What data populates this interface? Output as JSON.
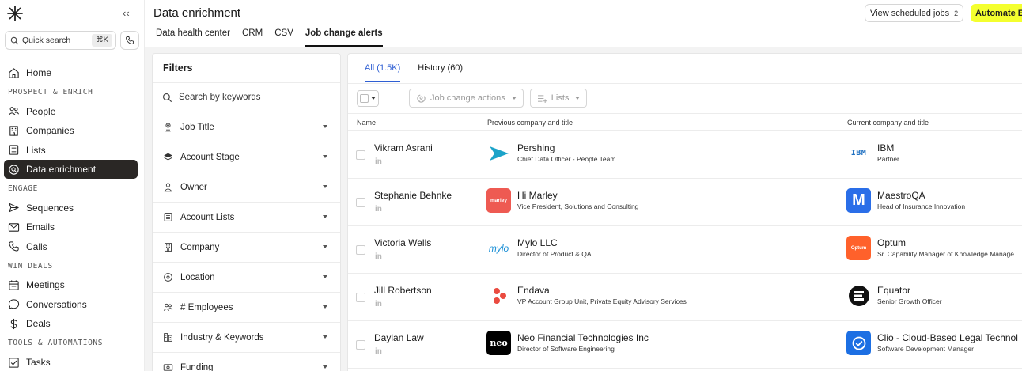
{
  "sidebar": {
    "collapse_label": "‹‹",
    "quick_search": "Quick search",
    "shortcut": "⌘K",
    "items": [
      {
        "type": "item",
        "label": "Home",
        "icon": "home-icon"
      },
      {
        "type": "section",
        "label": "PROSPECT & ENRICH"
      },
      {
        "type": "item",
        "label": "People",
        "icon": "people-icon"
      },
      {
        "type": "item",
        "label": "Companies",
        "icon": "building-icon"
      },
      {
        "type": "item",
        "label": "Lists",
        "icon": "list-icon"
      },
      {
        "type": "item",
        "label": "Data enrichment",
        "icon": "enrichment-icon",
        "active": true
      },
      {
        "type": "section",
        "label": "ENGAGE"
      },
      {
        "type": "item",
        "label": "Sequences",
        "icon": "send-icon"
      },
      {
        "type": "item",
        "label": "Emails",
        "icon": "mail-icon"
      },
      {
        "type": "item",
        "label": "Calls",
        "icon": "phone-icon"
      },
      {
        "type": "section",
        "label": "WIN DEALS"
      },
      {
        "type": "item",
        "label": "Meetings",
        "icon": "calendar-icon"
      },
      {
        "type": "item",
        "label": "Conversations",
        "icon": "chat-icon"
      },
      {
        "type": "item",
        "label": "Deals",
        "icon": "dollar-icon"
      },
      {
        "type": "section",
        "label": "TOOLS & AUTOMATIONS"
      },
      {
        "type": "item",
        "label": "Tasks",
        "icon": "checkbox-icon"
      }
    ]
  },
  "header": {
    "title": "Data enrichment",
    "tabs": [
      {
        "label": "Data health center",
        "active": false
      },
      {
        "label": "CRM",
        "active": false
      },
      {
        "label": "CSV",
        "active": false
      },
      {
        "label": "Job change alerts",
        "active": true
      }
    ],
    "scheduled_label": "View scheduled jobs",
    "scheduled_count": "2",
    "automate_label": "Automate En"
  },
  "filters": {
    "title": "Filters",
    "search_placeholder": "Search by keywords",
    "items": [
      {
        "label": "Job Title",
        "icon": "badge-icon"
      },
      {
        "label": "Account Stage",
        "icon": "layers-icon"
      },
      {
        "label": "Owner",
        "icon": "person-icon"
      },
      {
        "label": "Account Lists",
        "icon": "list-icon"
      },
      {
        "label": "Company",
        "icon": "building-icon"
      },
      {
        "label": "Location",
        "icon": "location-pin-icon"
      },
      {
        "label": "# Employees",
        "icon": "people-icon"
      },
      {
        "label": "Industry & Keywords",
        "icon": "industry-icon"
      },
      {
        "label": "Funding",
        "icon": "money-icon"
      }
    ]
  },
  "main": {
    "tabs": [
      {
        "label": "All (1.5K)",
        "active": true
      },
      {
        "label": "History (60)",
        "active": false
      }
    ],
    "actions_label": "Job change actions",
    "lists_label": "Lists",
    "columns": {
      "name": "Name",
      "previous": "Previous company and title",
      "current": "Current company and title"
    },
    "rows": [
      {
        "name": "Vikram Asrani",
        "li": "in",
        "prev_company": "Pershing",
        "prev_title": "Chief Data Officer - People Team",
        "prev_logo": "pershing",
        "curr_company": "IBM",
        "curr_title": "Partner",
        "curr_logo": "ibm"
      },
      {
        "name": "Stephanie Behnke",
        "li": "in",
        "prev_company": "Hi Marley",
        "prev_title": "Vice President, Solutions and Consulting",
        "prev_logo": "himarley",
        "prev_logo_text": "marley",
        "curr_company": "MaestroQA",
        "curr_title": "Head of Insurance Innovation",
        "curr_logo": "maestro",
        "curr_logo_text": "M"
      },
      {
        "name": "Victoria Wells",
        "li": "in",
        "prev_company": "Mylo LLC",
        "prev_title": "Director of Product & QA",
        "prev_logo": "mylo",
        "prev_logo_text": "mylo",
        "curr_company": "Optum",
        "curr_title": "Sr. Capability Manager of Knowledge Manage",
        "curr_logo": "optum",
        "curr_logo_text": "Optum"
      },
      {
        "name": "Jill Robertson",
        "li": "in",
        "prev_company": "Endava",
        "prev_title": "VP Account Group Unit, Private Equity Advisory Services",
        "prev_logo": "endava",
        "curr_company": "Equator",
        "curr_title": "Senior Growth Officer",
        "curr_logo": "equator"
      },
      {
        "name": "Daylan Law",
        "li": "in",
        "prev_company": "Neo Financial Technologies Inc",
        "prev_title": "Director of Software Engineering",
        "prev_logo": "neo",
        "prev_logo_text": "neo",
        "curr_company": "Clio - Cloud-Based Legal Technol",
        "curr_title": "Software Development Manager",
        "curr_logo": "clio"
      }
    ]
  },
  "colors": {
    "active_nav_bg": "#2a2725",
    "accent_blue": "#2f5fd3",
    "automate_yellow": "#f4ff2f",
    "pershing_teal": "#1ba3c9",
    "himarley_red": "#ee5a52",
    "maestro_blue": "#2a6ee8",
    "optum_orange": "#ff612b",
    "endava_red": "#ea4b40",
    "clio_blue": "#1c6fe3",
    "ibm_blue": "#1f70c1"
  }
}
